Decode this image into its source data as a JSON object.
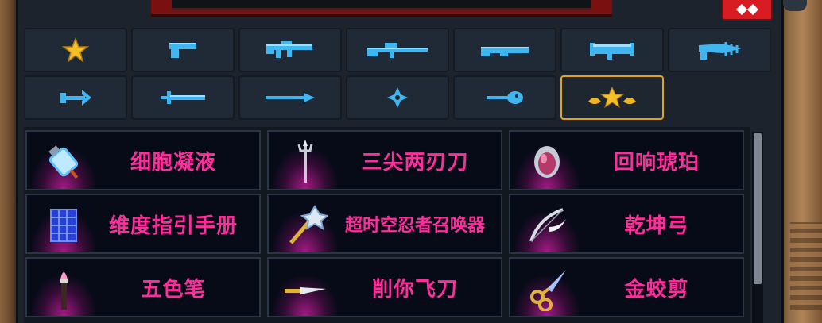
{
  "categories": [
    {
      "icon": "star-icon"
    },
    {
      "icon": "pistol-icon"
    },
    {
      "icon": "rifle-icon"
    },
    {
      "icon": "sniper-icon"
    },
    {
      "icon": "shotgun-icon"
    },
    {
      "icon": "launcher-icon"
    },
    {
      "icon": "drill-gun-icon"
    },
    {
      "icon": "bow-icon"
    },
    {
      "icon": "sword-icon"
    },
    {
      "icon": "spear-icon"
    },
    {
      "icon": "shuriken-icon"
    },
    {
      "icon": "staff-icon"
    },
    {
      "icon": "gold-stars-icon",
      "selected": true
    }
  ],
  "items": [
    {
      "name": "细胞凝液",
      "icon": "cell-fluid-icon"
    },
    {
      "name": "三尖两刃刀",
      "icon": "trident-icon"
    },
    {
      "name": "回响琥珀",
      "icon": "amber-gem-icon"
    },
    {
      "name": "维度指引手册",
      "icon": "manual-icon"
    },
    {
      "name": "超时空忍者召唤器",
      "icon": "summoner-wand-icon"
    },
    {
      "name": "乾坤弓",
      "icon": "winged-bow-icon"
    },
    {
      "name": "五色笔",
      "icon": "brush-icon"
    },
    {
      "name": "削你飞刀",
      "icon": "flying-knife-icon"
    },
    {
      "name": "金蛟剪",
      "icon": "golden-scissors-icon"
    }
  ],
  "colors": {
    "accent_text": "#ff2d9b",
    "weapon_icon": "#3fb6ef",
    "selected_border": "#e3a21a",
    "close_button": "#d81c22"
  }
}
